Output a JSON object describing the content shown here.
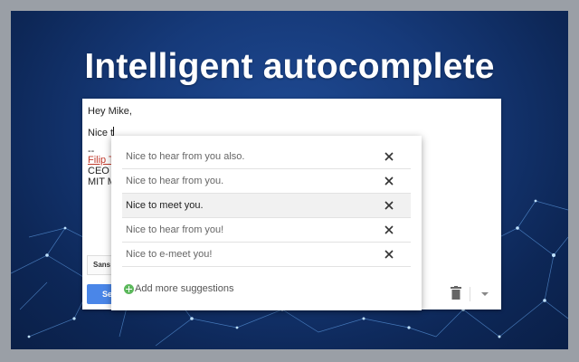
{
  "hero": {
    "title": "Intelligent autocomplete"
  },
  "compose": {
    "greeting": "Hey Mike,",
    "typed_text": "Nice t",
    "signature": {
      "dash": "--",
      "name": "Filip T",
      "role": "CEO",
      "org": "MIT M"
    },
    "format_label": "Sans",
    "send_label": "Se"
  },
  "autocomplete": {
    "suggestions": [
      {
        "label": "Nice to hear from you also.",
        "active": false
      },
      {
        "label": "Nice to hear from you.",
        "active": false
      },
      {
        "label": "Nice to meet you.",
        "active": true
      },
      {
        "label": "Nice to hear from you!",
        "active": false
      },
      {
        "label": "Nice to e-meet you!",
        "active": false
      }
    ],
    "add_more_label": "Add more suggestions"
  },
  "colors": {
    "background_blue": "#163a7a",
    "send_button": "#4a86e8",
    "add_icon_green": "#5cb85c"
  },
  "icons": [
    "close-icon",
    "plus-icon",
    "trash-icon",
    "chevron-down-icon",
    "text-format-icon"
  ]
}
